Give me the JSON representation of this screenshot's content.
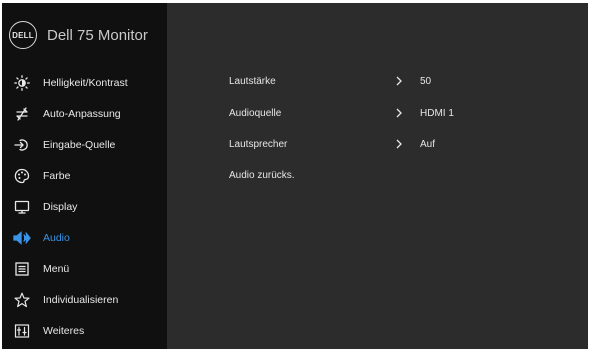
{
  "header": {
    "logo_text": "DELL",
    "model": "Dell 75 Monitor"
  },
  "sidebar": {
    "items": [
      {
        "label": "Helligkeit/Kontrast",
        "icon": "brightness-icon"
      },
      {
        "label": "Auto-Anpassung",
        "icon": "auto-adjust-icon"
      },
      {
        "label": "Eingabe-Quelle",
        "icon": "input-source-icon"
      },
      {
        "label": "Farbe",
        "icon": "color-palette-icon"
      },
      {
        "label": "Display",
        "icon": "display-icon"
      },
      {
        "label": "Audio",
        "icon": "speaker-icon",
        "active": true
      },
      {
        "label": "Menü",
        "icon": "menu-icon"
      },
      {
        "label": "Individualisieren",
        "icon": "star-icon"
      },
      {
        "label": "Weiteres",
        "icon": "others-icon"
      }
    ]
  },
  "audio": {
    "rows": [
      {
        "label": "Lautstärke",
        "value": "50"
      },
      {
        "label": "Audioquelle",
        "value": "HDMI 1"
      },
      {
        "label": "Lautsprecher",
        "value": "Auf"
      },
      {
        "label": "Audio zurücks.",
        "value": ""
      }
    ]
  },
  "colors": {
    "active": "#3a93e6",
    "sidebar_bg": "#101010",
    "content_bg": "#2c2c2c"
  }
}
